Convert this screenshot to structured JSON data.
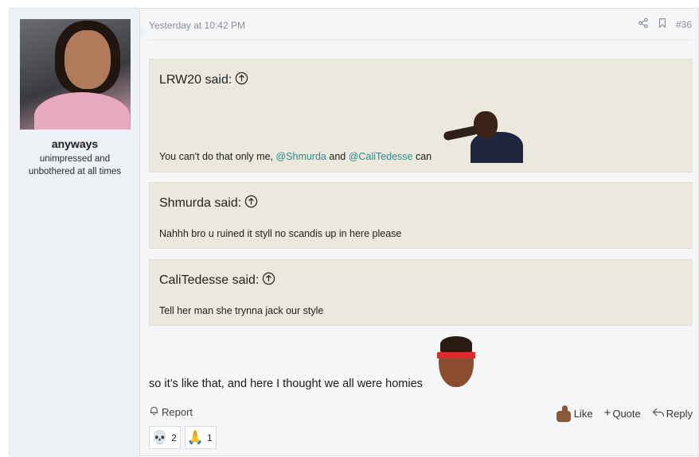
{
  "user": {
    "name": "anyways",
    "title": "unimpressed and unbothered at all times"
  },
  "post": {
    "date": "Yesterday at 10:42 PM",
    "number": "#36"
  },
  "quotes": [
    {
      "author_label": "LRW20 said:",
      "text_before": "You can't do that only me, ",
      "mention1": "@Shmurda",
      "text_mid": " and ",
      "mention2": "@CaliTedesse",
      "text_after": " can"
    },
    {
      "author_label": "Shmurda said:",
      "text": "Nahhh bro u ruined it styll no scandis up in here please"
    },
    {
      "author_label": "CaliTedesse said:",
      "text": "Tell her man she trynna jack our style"
    }
  ],
  "reply_text": "so it’s like that, and here I thought we all were homies",
  "footer": {
    "report": "Report",
    "like": "Like",
    "quote": "Quote",
    "reply": "Reply"
  },
  "reactions": [
    {
      "emoji": "💀",
      "count": "2"
    },
    {
      "emoji": "🙏",
      "count": "1"
    }
  ],
  "icons": [
    "share-icon",
    "bookmark-icon",
    "arrow-up-circle-icon",
    "bell-icon",
    "thumbs-up-icon",
    "plus-icon",
    "reply-arrow-icon"
  ]
}
